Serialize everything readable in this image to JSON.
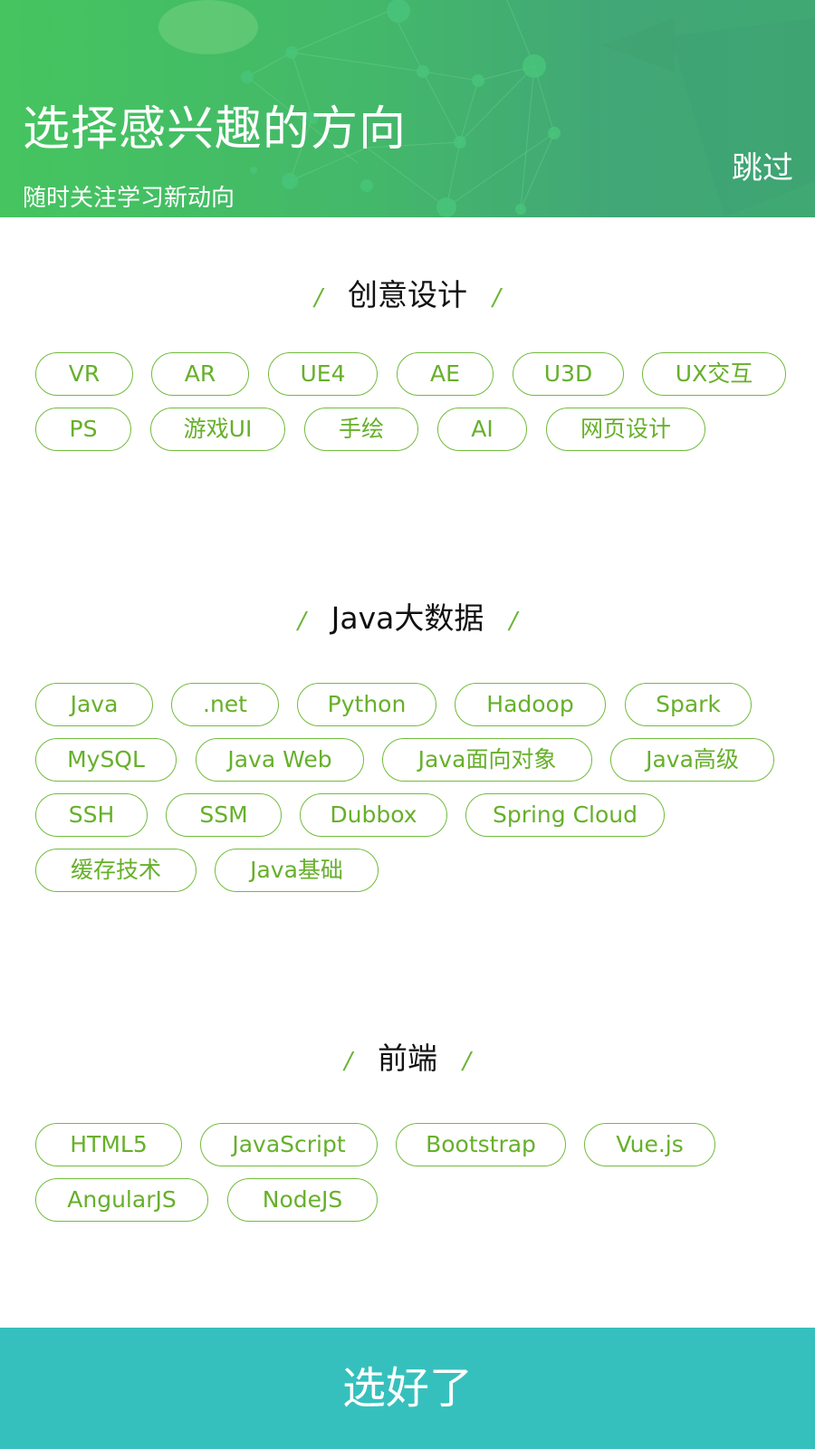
{
  "header": {
    "title": "选择感兴趣的方向",
    "subtitle": "随时关注学习新动向",
    "skip_label": "跳过"
  },
  "sections": [
    {
      "title": "创意设计",
      "tags": [
        "VR",
        "AR",
        "UE4",
        "AE",
        "U3D",
        "UX交互",
        "PS",
        "游戏UI",
        "手绘",
        "AI",
        "网页设计"
      ]
    },
    {
      "title": "Java大数据",
      "tags": [
        "Java",
        ".net",
        "Python",
        "Hadoop",
        "Spark",
        "MySQL",
        "Java Web",
        "Java面向对象",
        "Java高级",
        "SSH",
        "SSM",
        "Dubbox",
        "Spring Cloud",
        "缓存技术",
        "Java基础"
      ]
    },
    {
      "title": "前端",
      "tags": [
        "HTML5",
        "JavaScript",
        "Bootstrap",
        "Vue.js",
        "AngularJS",
        "NodeJS"
      ]
    }
  ],
  "slash": "/",
  "footer": {
    "done_label": "选好了"
  },
  "colors": {
    "accent_green": "#66b02a",
    "chip_border": "#72bb3c",
    "button_teal": "#36c0bd",
    "header_green": "#45c45f"
  }
}
